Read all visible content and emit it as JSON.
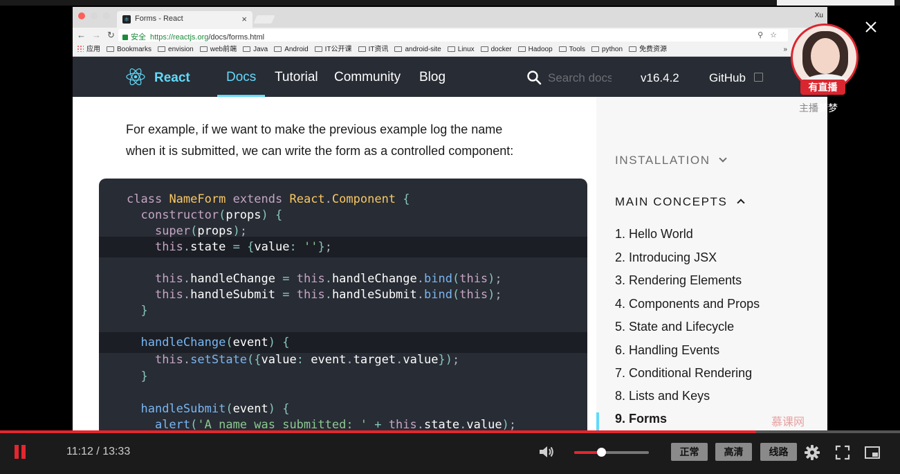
{
  "browser": {
    "tab_title": "Forms - React",
    "tab_close": "×",
    "profile": "Xu",
    "secure_label": "安全",
    "url_host": "https://reactjs.org",
    "url_path": "/docs/forms.html",
    "url_right_icons": "⚲☆",
    "bookmarks": [
      "应用",
      "Bookmarks",
      "envision",
      "web前端",
      "Java",
      "Android",
      "IT公开课",
      "IT资讯",
      "android-site",
      "Linux",
      "docker",
      "Hadoop",
      "Tools",
      "python",
      "免费资源"
    ],
    "bookmarks_more": "»"
  },
  "react_nav": {
    "brand": "React",
    "links": [
      "Docs",
      "Tutorial",
      "Community",
      "Blog"
    ],
    "active": "Docs",
    "search_placeholder": "Search docs",
    "version": "v16.4.2",
    "github": "GitHub"
  },
  "content": {
    "intro_line1": "For example, if we want to make the previous example log the name",
    "intro_line2": "when it is submitted, we can write the form as a controlled component:"
  },
  "code": {
    "language": "javascript",
    "highlighted_lines": [
      3,
      9
    ],
    "lines": [
      "class NameForm extends React.Component {",
      "  constructor(props) {",
      "    super(props);",
      "    this.state = {value: ''};",
      "",
      "    this.handleChange = this.handleChange.bind(this);",
      "    this.handleSubmit = this.handleSubmit.bind(this);",
      "  }",
      "",
      "  handleChange(event) {",
      "    this.setState({value: event.target.value});",
      "  }",
      "",
      "  handleSubmit(event) {",
      "    alert('A name was submitted: ' + this.state.value);"
    ]
  },
  "sidebar": {
    "installation": "INSTALLATION",
    "main_concepts": "MAIN CONCEPTS",
    "items": [
      "1. Hello World",
      "2. Introducing JSX",
      "3. Rendering Elements",
      "4. Components and Props",
      "5. State and Lifecycle",
      "6. Handling Events",
      "7. Conditional Rendering",
      "8. Lists and Keys",
      "9. Forms"
    ],
    "active_item": "9. Forms",
    "watermark": "慕课网"
  },
  "live": {
    "badge": "有直播",
    "host_prefix": "主播",
    "host_name": "梦梦"
  },
  "player": {
    "time": "11:12 / 13:33",
    "progress_fraction": 0.8402,
    "volume_fraction": 0.36,
    "quality_buttons": [
      "正常",
      "高清",
      "线路"
    ],
    "accent": "#e5262e"
  },
  "colors": {
    "react_blue": "#61dafb",
    "nav_bg": "#282c34",
    "code_bg": "#282c34"
  }
}
